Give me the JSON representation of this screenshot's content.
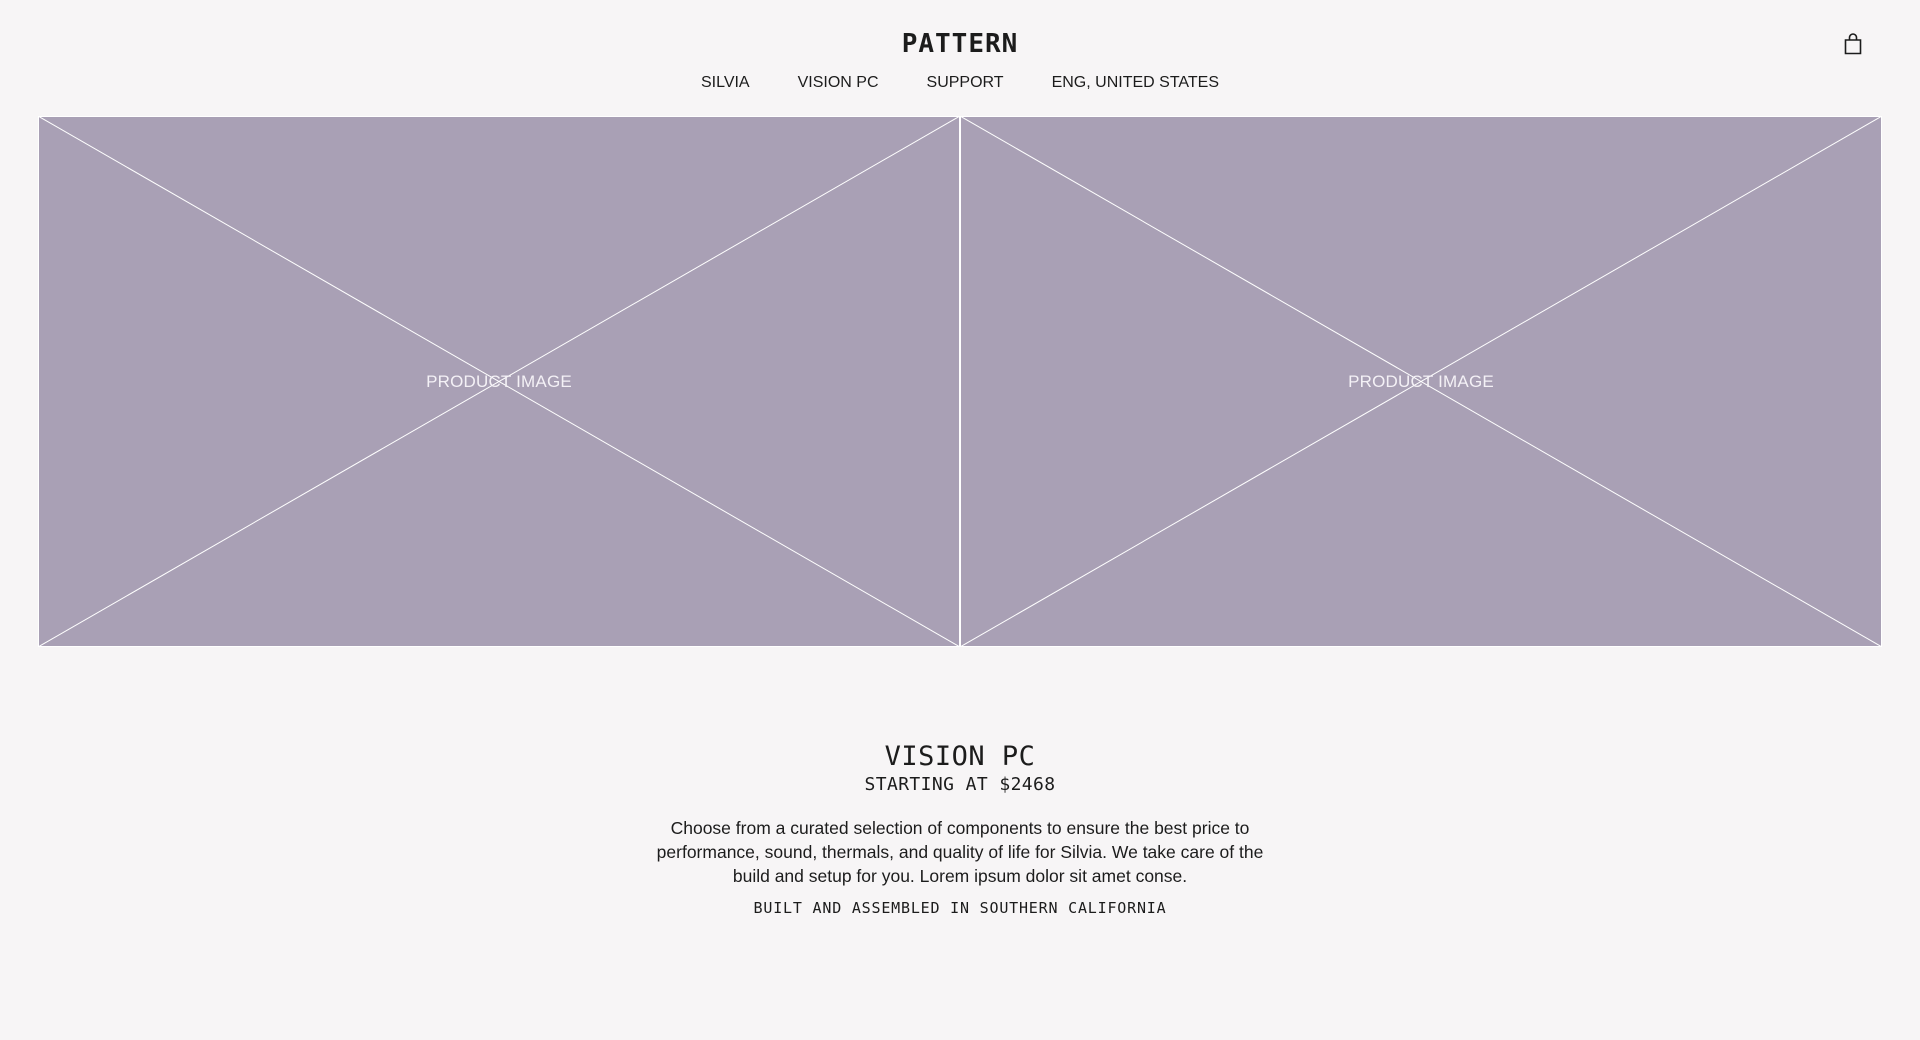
{
  "header": {
    "logo": "PATTERN",
    "cart_icon": "shopping-bag-icon",
    "nav": [
      {
        "label": "SILVIA"
      },
      {
        "label": "VISION PC"
      },
      {
        "label": "SUPPORT"
      },
      {
        "label": "ENG, UNITED STATES"
      }
    ]
  },
  "gallery": {
    "images": [
      {
        "label": "PRODUCT IMAGE"
      },
      {
        "label": "PRODUCT IMAGE"
      }
    ],
    "placeholder_color": "#a9a0b5"
  },
  "product": {
    "title": "VISION PC",
    "price": "STARTING AT $2468",
    "description": "Choose from a curated selection of components to ensure the best price to performance, sound, thermals, and quality of life for Silvia. We take care of the build and setup for you. Lorem ipsum dolor sit amet conse.",
    "origin": "BUILT AND ASSEMBLED IN SOUTHERN CALIFORNIA"
  }
}
